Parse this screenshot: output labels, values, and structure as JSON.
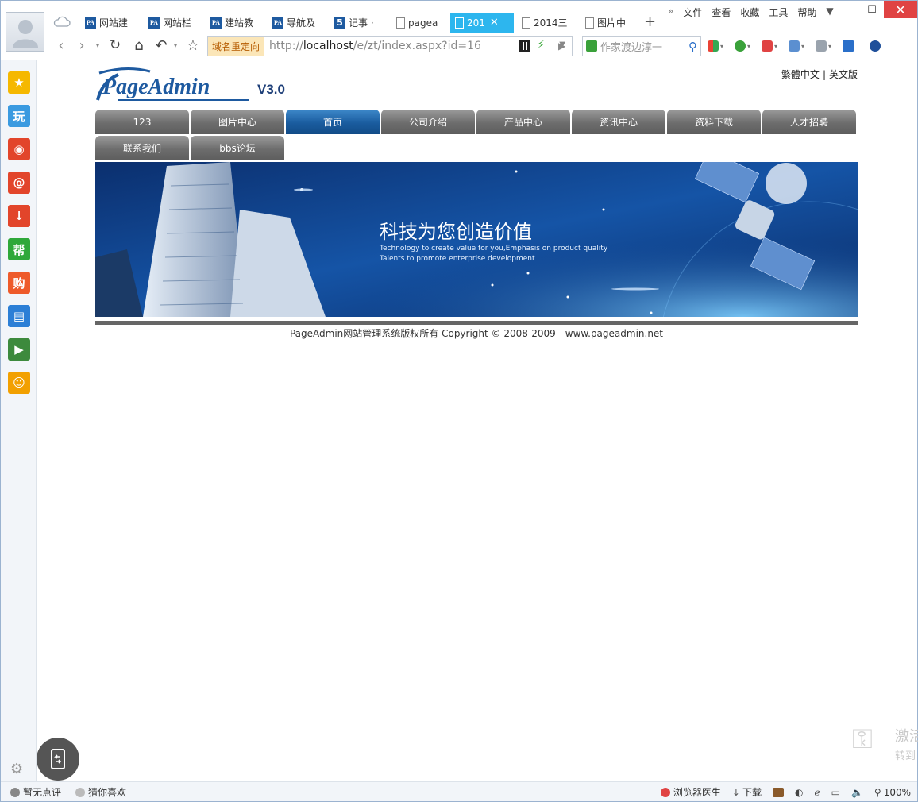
{
  "browser": {
    "tabs": [
      {
        "label": "网站建",
        "icon": "pa",
        "active": false
      },
      {
        "label": "网站栏",
        "icon": "pa",
        "active": false
      },
      {
        "label": "建站教",
        "icon": "pa",
        "active": false
      },
      {
        "label": "导航及",
        "icon": "pa",
        "active": false
      },
      {
        "label": "记事 ·",
        "icon": "five",
        "active": false
      },
      {
        "label": "pagea",
        "icon": "doc",
        "active": false
      },
      {
        "label": "201",
        "icon": "doc",
        "active": true
      },
      {
        "label": "2014三",
        "icon": "doc",
        "active": false
      },
      {
        "label": "图片中",
        "icon": "doc",
        "active": false
      }
    ],
    "new_tab": "+",
    "menu": {
      "overflow": "»",
      "file": "文件",
      "view": "查看",
      "favorites": "收藏",
      "tools": "工具",
      "help": "帮助"
    },
    "address": {
      "redirect_label": "域名重定向",
      "url_prefix": "http://",
      "url_host": "localhost",
      "url_path": "/e/zt/index.aspx?id=16"
    },
    "search": {
      "placeholder": "作家渡边淳一"
    }
  },
  "sidebar": {
    "items": [
      {
        "icon": "star-icon",
        "glyph": "★",
        "color": "#f5b800"
      },
      {
        "icon": "play-icon",
        "glyph": "玩",
        "color": "#3a9ae0"
      },
      {
        "icon": "weibo-icon",
        "glyph": "◉",
        "color": "#e2452b"
      },
      {
        "icon": "mail-icon",
        "glyph": "@",
        "color": "#e2452b"
      },
      {
        "icon": "download-icon",
        "glyph": "↓",
        "color": "#e2452b"
      },
      {
        "icon": "help-icon",
        "glyph": "帮",
        "color": "#2fa83a"
      },
      {
        "icon": "shop-icon",
        "glyph": "购",
        "color": "#ee5a2a"
      },
      {
        "icon": "book-icon",
        "glyph": "▤",
        "color": "#2c7fd6"
      },
      {
        "icon": "video-icon",
        "glyph": "▶",
        "color": "#3d8a3d"
      },
      {
        "icon": "emoji-icon",
        "glyph": "☺",
        "color": "#f2a000"
      }
    ]
  },
  "page": {
    "logo_text": "PageAdmin",
    "logo_version": "V3.0",
    "lang_traditional": "繁體中文",
    "lang_sep": "|",
    "lang_english": "英文版",
    "nav": [
      "123",
      "图片中心",
      "首页",
      "公司介绍",
      "产品中心",
      "资讯中心",
      "资料下载",
      "人才招聘",
      "联系我们",
      "bbs论坛"
    ],
    "nav_active": "首页",
    "banner_title": "科技为您创造价值",
    "banner_sub1": "Technology to create value for you,Emphasis on product quality",
    "banner_sub2": "Talents to promote enterprise development",
    "copyright": "PageAdmin网站管理系统版权所有 Copyright © 2008-2009",
    "website": "www.pageadmin.net"
  },
  "watermark": {
    "line1": "激活",
    "line2": "转到"
  },
  "statusbar": {
    "no_review": "暂无点评",
    "guess": "猜你喜欢",
    "doctor": "浏览器医生",
    "download": "下载",
    "zoom": "100%"
  }
}
